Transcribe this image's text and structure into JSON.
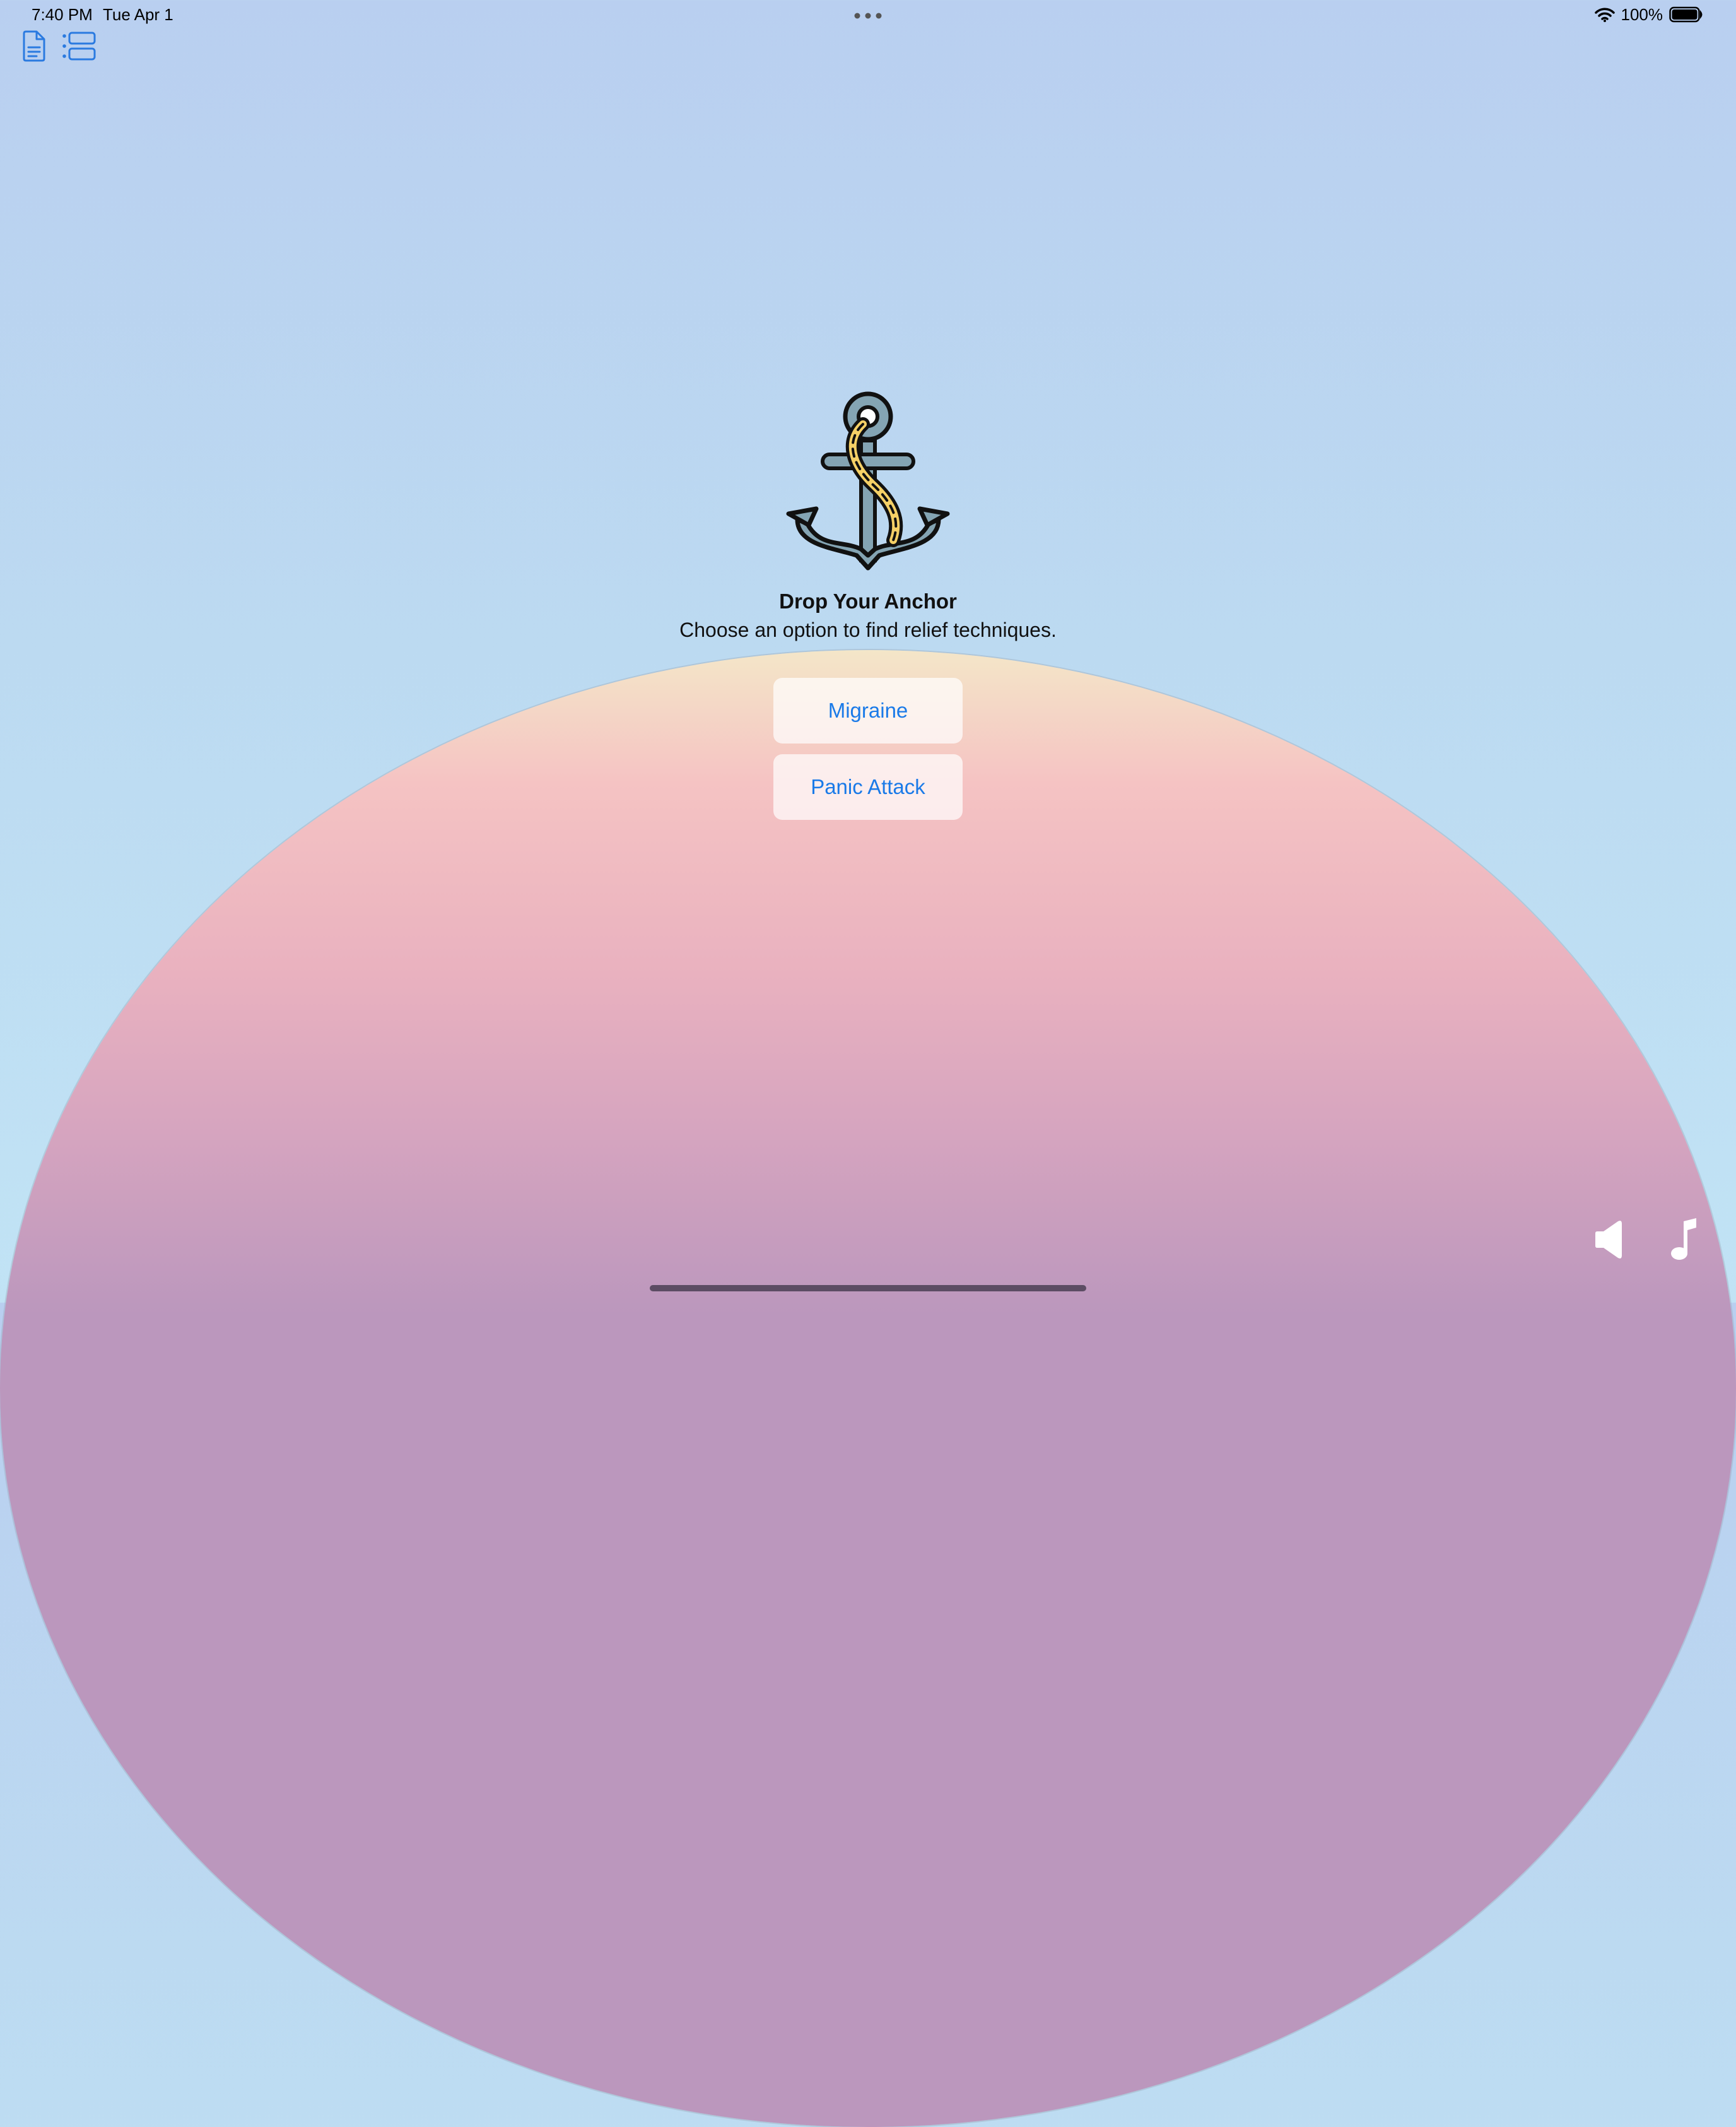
{
  "status_bar": {
    "time": "7:40 PM",
    "date": "Tue Apr 1",
    "battery_percent": "100%",
    "icons": [
      "wifi-icon",
      "battery-icon",
      "multitasking-dots-icon"
    ]
  },
  "toolbar": {
    "icons": [
      "document-icon",
      "list-view-icon"
    ]
  },
  "main": {
    "logo_icon": "anchor-icon",
    "title": "Drop Your Anchor",
    "subtitle": "Choose an option to find relief techniques.",
    "options": [
      {
        "label": "Migraine"
      },
      {
        "label": "Panic Attack"
      }
    ]
  },
  "controls": {
    "icons": [
      "speaker-icon",
      "music-note-icon"
    ]
  },
  "colors": {
    "accent": "#1a7ae8",
    "sky_top": "#b9cff0",
    "sky_bottom": "#c1e3f5",
    "hill_top": "#f4e6c8",
    "hill_pink": "#f5c3c3",
    "hill_bottom": "#bb97bd",
    "anchor_fill": "#84a4b3",
    "rope": "#f5d066"
  }
}
